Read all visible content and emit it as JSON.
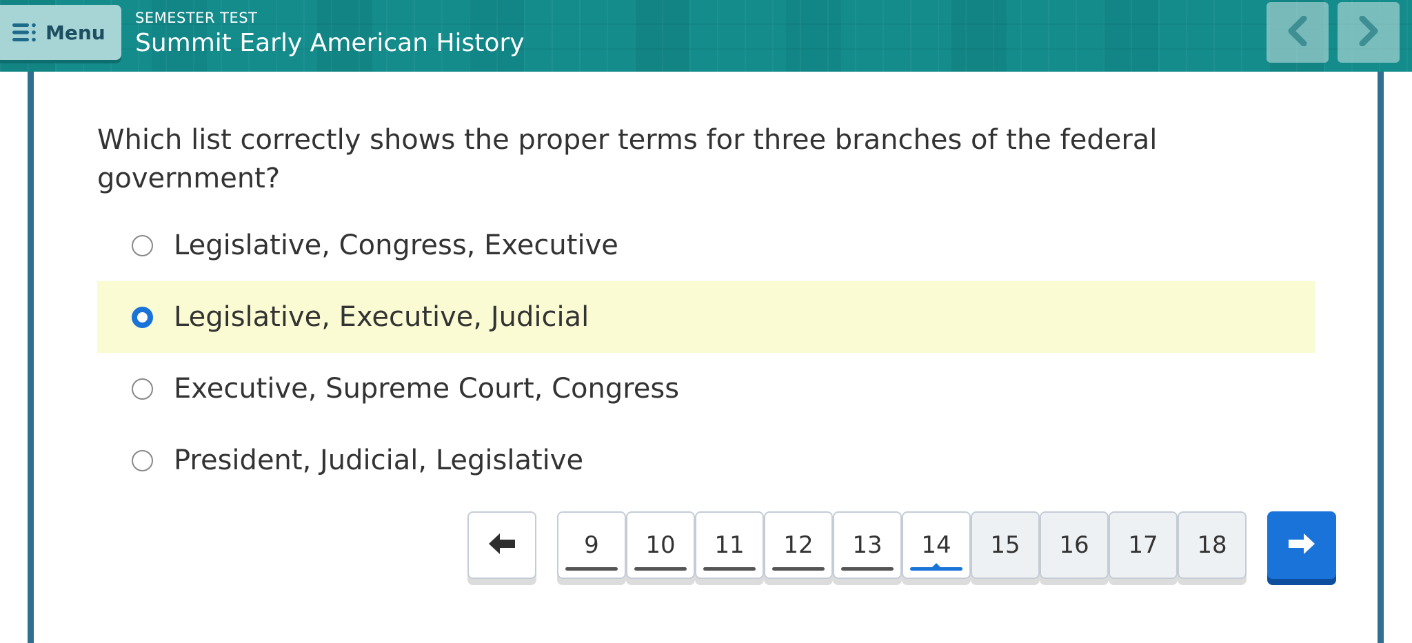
{
  "header": {
    "menu_label": "Menu",
    "subtitle": "SEMESTER TEST",
    "title": "Summit Early American History",
    "prev_icon": "chevron-left-icon",
    "next_icon": "chevron-right-icon"
  },
  "question": {
    "text": "Which list correctly shows the proper terms for three branches of the federal government?"
  },
  "options": [
    {
      "label": "Legislative, Congress, Executive",
      "selected": false
    },
    {
      "label": "Legislative, Executive, Judicial",
      "selected": true
    },
    {
      "label": "Executive, Supreme Court, Congress",
      "selected": false
    },
    {
      "label": "President, Judicial, Legislative",
      "selected": false
    }
  ],
  "pagination": {
    "back_icon": "arrow-left-icon",
    "next_icon": "arrow-right-icon",
    "current_page": "14",
    "pages": [
      {
        "number": "9",
        "visited": true
      },
      {
        "number": "10",
        "visited": true
      },
      {
        "number": "11",
        "visited": true
      },
      {
        "number": "12",
        "visited": true
      },
      {
        "number": "13",
        "visited": true
      },
      {
        "number": "14",
        "visited": true
      },
      {
        "number": "15",
        "visited": false
      },
      {
        "number": "16",
        "visited": false
      },
      {
        "number": "17",
        "visited": false
      },
      {
        "number": "18",
        "visited": false
      }
    ]
  },
  "colors": {
    "header_teal": "#148c8c",
    "frame_border": "#2f6f8f",
    "selected_highlight": "#fafbd3",
    "accent_blue": "#1a73d9"
  }
}
